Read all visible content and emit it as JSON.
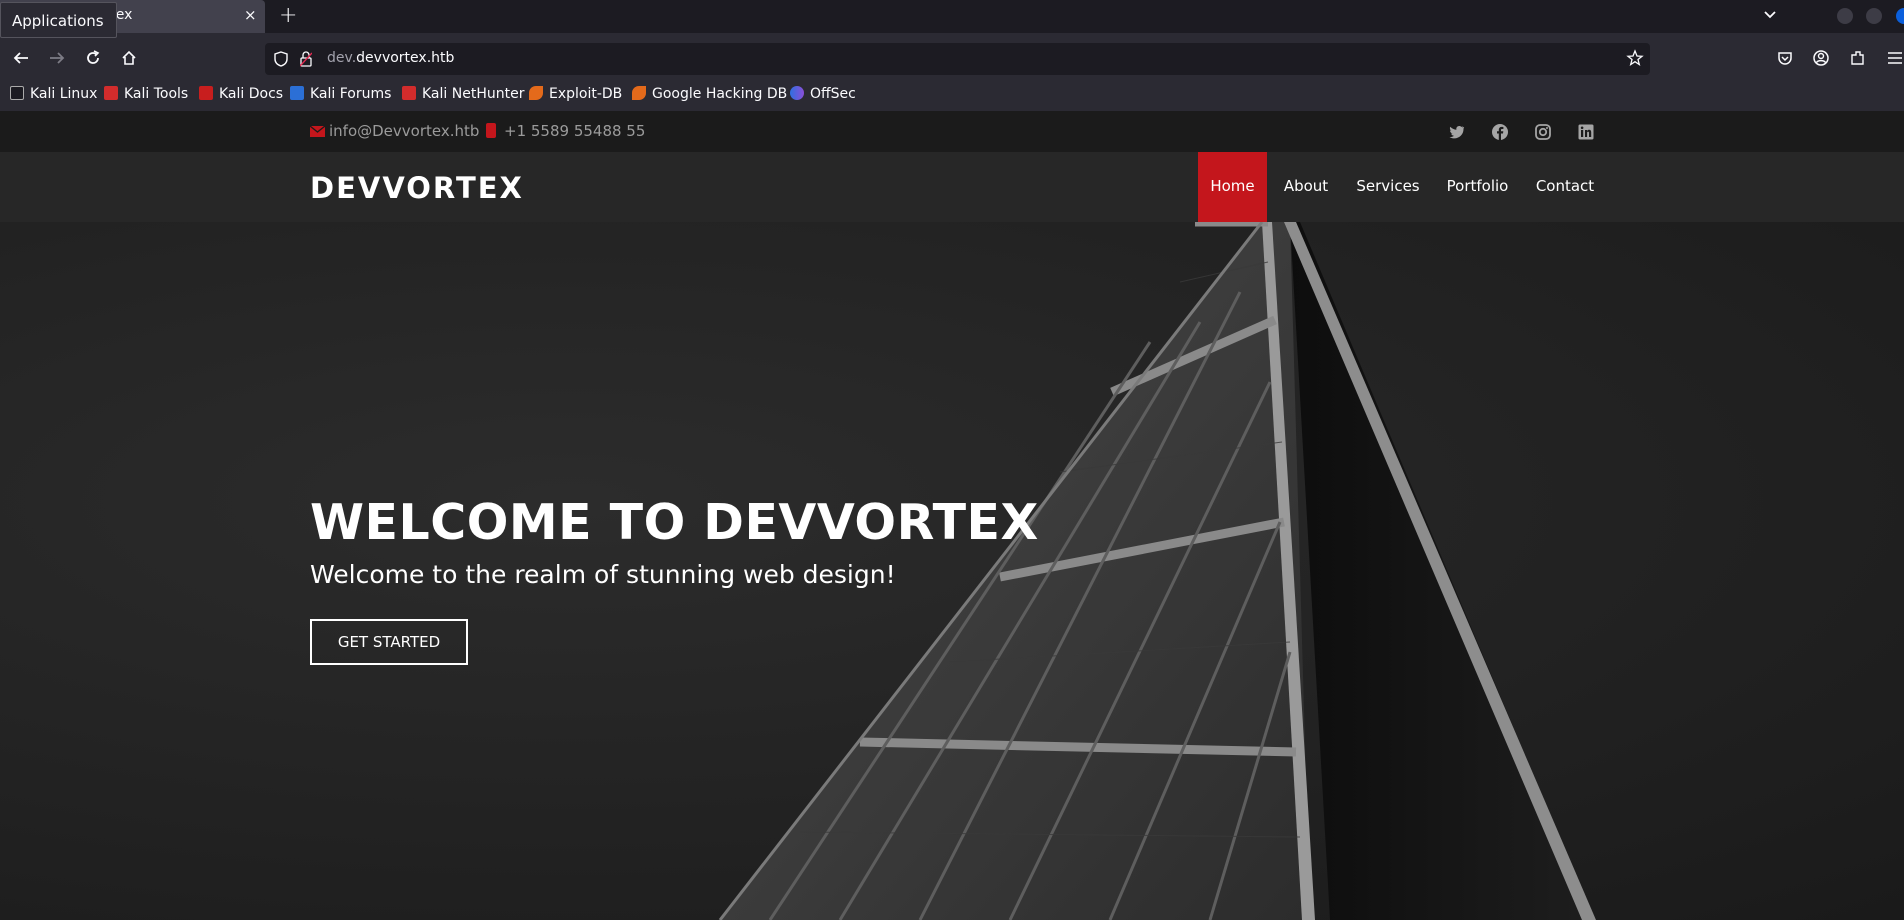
{
  "browser": {
    "tab_title": "Devvortex",
    "tooltip": "Applications",
    "new_tab": "+",
    "tab_close": "×",
    "url_prefix": "dev.",
    "url_domain": "devvortex.htb",
    "accent_color": "#0b5fdc"
  },
  "bookmarks": [
    {
      "label": "Kali Linux",
      "icon": "kali-dragon-icon"
    },
    {
      "label": "Kali Tools",
      "icon": "kali-tools-icon"
    },
    {
      "label": "Kali Docs",
      "icon": "kali-docs-icon"
    },
    {
      "label": "Kali Forums",
      "icon": "kali-forums-icon"
    },
    {
      "label": "Kali NetHunter",
      "icon": "kali-nethunter-icon"
    },
    {
      "label": "Exploit-DB",
      "icon": "exploit-db-icon"
    },
    {
      "label": "Google Hacking DB",
      "icon": "ghdb-icon"
    },
    {
      "label": "OffSec",
      "icon": "offsec-icon"
    }
  ],
  "site": {
    "email": "info@Devvortex.htb",
    "phone": "+1 5589 55488 55",
    "logo": "DEVVORTEX",
    "menu": [
      "Home",
      "About",
      "Services",
      "Portfolio",
      "Contact"
    ],
    "active_menu": "Home",
    "brand_color": "#c4161c",
    "hero": {
      "title": "WELCOME TO DEVVORTEX",
      "subtitle": "Welcome to the realm of stunning web design!",
      "cta": "GET STARTED"
    },
    "social_icons": [
      "twitter-icon",
      "facebook-icon",
      "instagram-icon",
      "linkedin-icon"
    ]
  }
}
